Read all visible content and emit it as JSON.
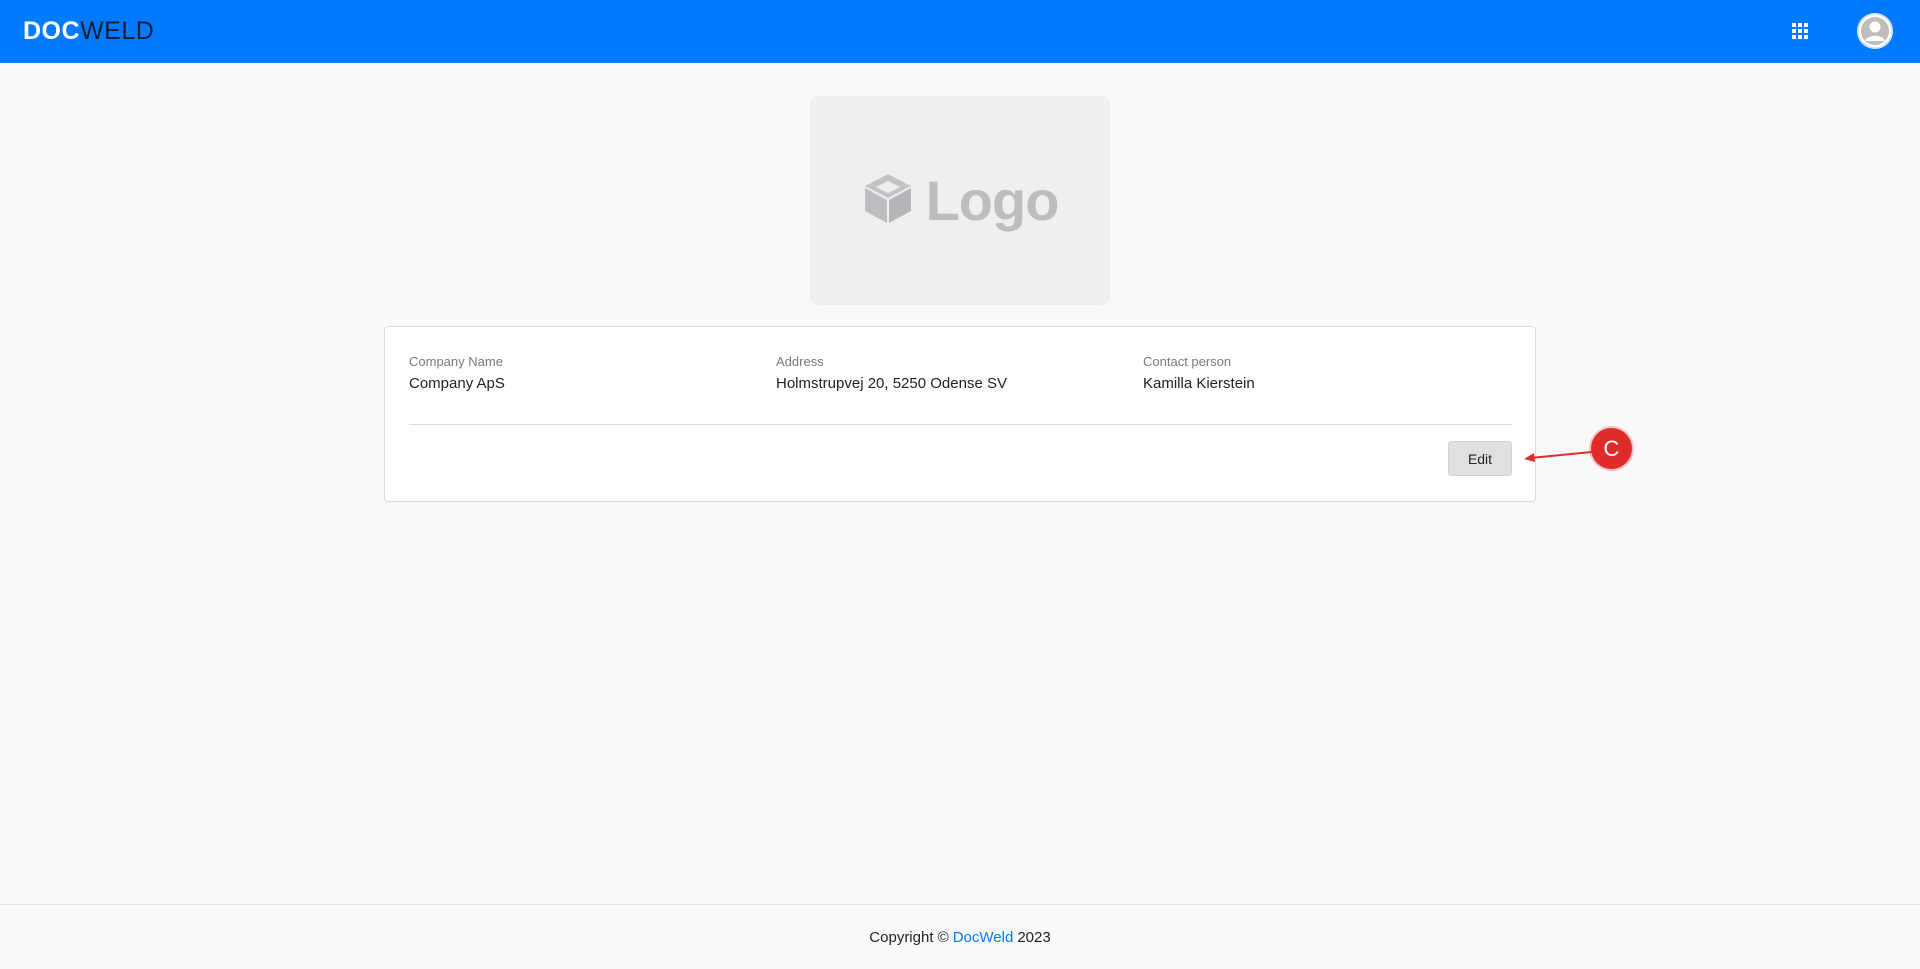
{
  "header": {
    "brand_doc": "DOC",
    "brand_weld": "WELD",
    "apps_icon": "grid-icon",
    "avatar_icon": "user-avatar-icon",
    "bg_color": "#007bff"
  },
  "logo_placeholder": {
    "icon": "cube-icon",
    "text": "Logo"
  },
  "company": {
    "name_label": "Company Name",
    "name_value": "Company ApS",
    "address_label": "Address",
    "address_value": "Holmstrupvej 20, 5250 Odense SV",
    "contact_label": "Contact person",
    "contact_value": "Kamilla Kierstein",
    "edit_label": "Edit"
  },
  "annotation": {
    "marker_label": "C",
    "color": "#e02b2b"
  },
  "footer": {
    "prefix": "Copyright ©",
    "link": "DocWeld",
    "year": "2023"
  }
}
